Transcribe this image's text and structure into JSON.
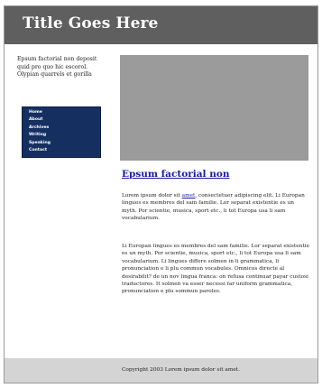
{
  "header": {
    "title": "Title Goes Here"
  },
  "sidebar": {
    "intro": "Epsum factorial non deposit quid pro quo hic escorol. Olypian quarrels et gorilla",
    "nav": [
      "Home",
      "About",
      "Archives",
      "Writing",
      "Speaking",
      "Contact"
    ]
  },
  "main": {
    "image_placeholder": "",
    "title": "Epsum factorial non",
    "p1_before": "Lorem ipsum dolor sit ",
    "p1_link": "amet",
    "p1_after": ", consectetuer adipiscing elit. Li Europan lingues es membres del sam familie. Lor separat existentie es un myth. Por scientie, musica, sport etc., li tot Europa usa li sam vocabularium.",
    "p2": "Li Europan lingues es membres del sam familie. Lor separat existentie es un myth. Por scientie, musica, sport etc., li tot Europa usa li sam vocabularium. Li lingues differe solmen in li grammatica, li pronunciation e li plu commun vocabules. Omnicos directe al desirabilit? de un nov lingua franca: on refusa continuar payar custosi traductores. It solmen va esser necessi far uniform grammatica, pronunciation e plu sommun paroles."
  },
  "footer": {
    "copyright": "Copyright 2003 Lorem ipsum dolor sit amet."
  },
  "colors": {
    "header_bg": "#5f5f5f",
    "nav_bg": "#153060",
    "link": "#1a1aa6",
    "placeholder": "#9b9b9b",
    "footer_bg": "#d4d4d4"
  }
}
